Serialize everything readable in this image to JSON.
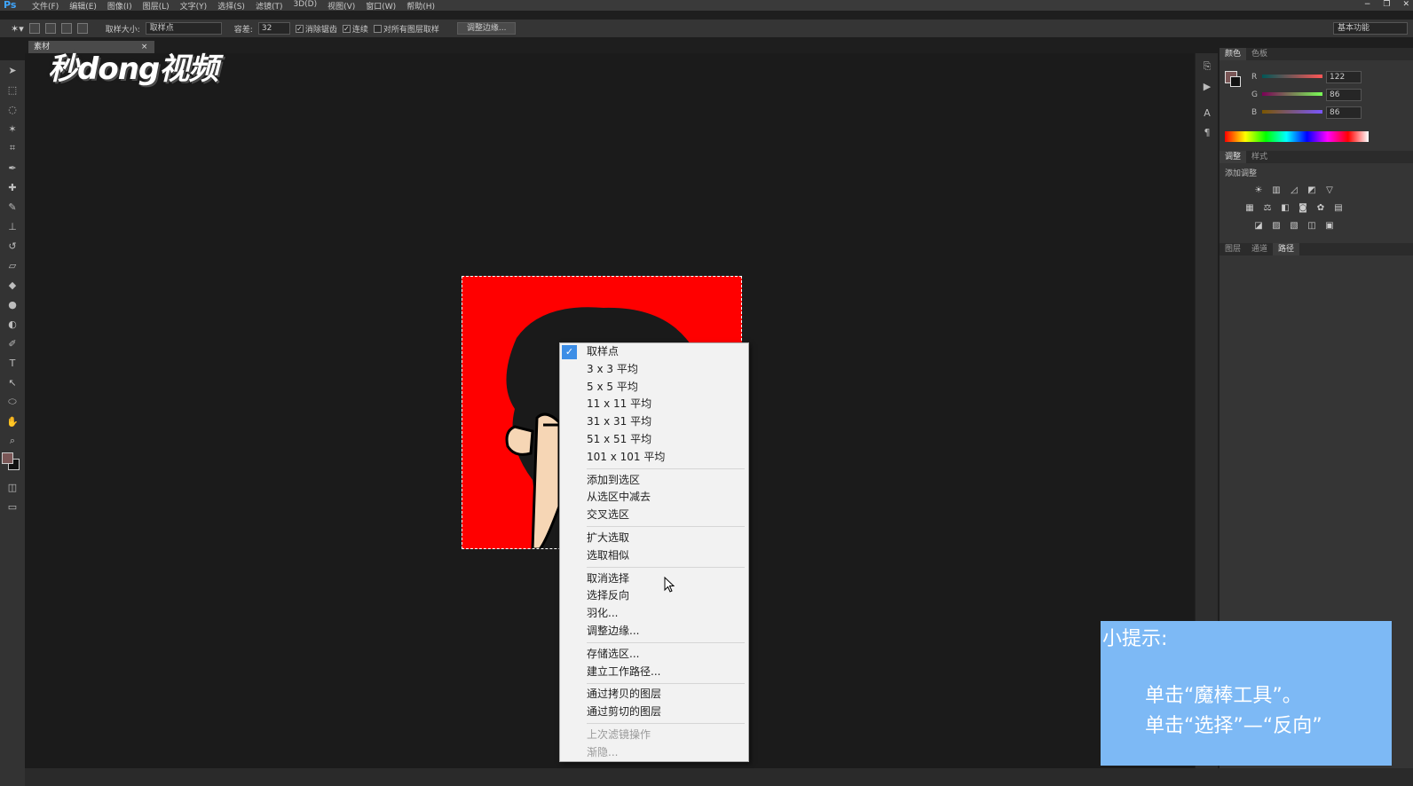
{
  "app": {
    "logo": "Ps",
    "menu": [
      "文件(F)",
      "编辑(E)",
      "图像(I)",
      "图层(L)",
      "文字(Y)",
      "选择(S)",
      "滤镜(T)",
      "3D(D)",
      "视图(V)",
      "窗口(W)",
      "帮助(H)"
    ],
    "window_controls": [
      "−",
      "❐",
      "✕"
    ]
  },
  "options_bar": {
    "sample_size_label": "取样大小:",
    "sample_size_value": "取样点",
    "tolerance_label": "容差:",
    "tolerance_value": "32",
    "anti_alias_label": "消除锯齿",
    "contiguous_label": "连续",
    "sample_all_layers_label": "对所有图层取样",
    "refine_edge_button": "调整边缘...",
    "workspace": "基本功能"
  },
  "document": {
    "tab_label": "素材",
    "tab_close": "×"
  },
  "watermark": "秒dong视频",
  "context_menu": {
    "checked_index": 0,
    "groups": [
      [
        {
          "label": "取样点"
        },
        {
          "label": "3 x 3 平均"
        },
        {
          "label": "5 x 5 平均"
        },
        {
          "label": "11 x 11 平均"
        },
        {
          "label": "31 x 31 平均"
        },
        {
          "label": "51 x 51 平均"
        },
        {
          "label": "101 x 101 平均"
        }
      ],
      [
        {
          "label": "添加到选区"
        },
        {
          "label": "从选区中减去"
        },
        {
          "label": "交叉选区"
        }
      ],
      [
        {
          "label": "扩大选取"
        },
        {
          "label": "选取相似"
        }
      ],
      [
        {
          "label": "取消选择"
        },
        {
          "label": "选择反向"
        },
        {
          "label": "羽化..."
        },
        {
          "label": "调整边缘..."
        }
      ],
      [
        {
          "label": "存储选区..."
        },
        {
          "label": "建立工作路径..."
        }
      ],
      [
        {
          "label": "通过拷贝的图层"
        },
        {
          "label": "通过剪切的图层"
        }
      ],
      [
        {
          "label": "上次滤镜操作",
          "disabled": true
        },
        {
          "label": "渐隐...",
          "disabled": true
        }
      ]
    ]
  },
  "color_panel": {
    "tabs": [
      "颜色",
      "色板"
    ],
    "r": "122",
    "g": "86",
    "b": "86",
    "r_label": "R",
    "g_label": "G",
    "b_label": "B",
    "foreground": "#7a5656"
  },
  "adjust_panel": {
    "tabs": [
      "调整",
      "样式"
    ],
    "title": "添加调整"
  },
  "layers_panel": {
    "tabs": [
      "图层",
      "通道",
      "路径"
    ]
  },
  "tip": {
    "title": "小提示:",
    "line1": "单击“魔棒工具”。",
    "line2": "单击“选择”—“反向”"
  },
  "colors": {
    "canvas_bg": "#1b1b1b",
    "art_bg": "#ff0000",
    "tip_bg": "#7db9f5",
    "menu_check": "#3d8ee6"
  }
}
